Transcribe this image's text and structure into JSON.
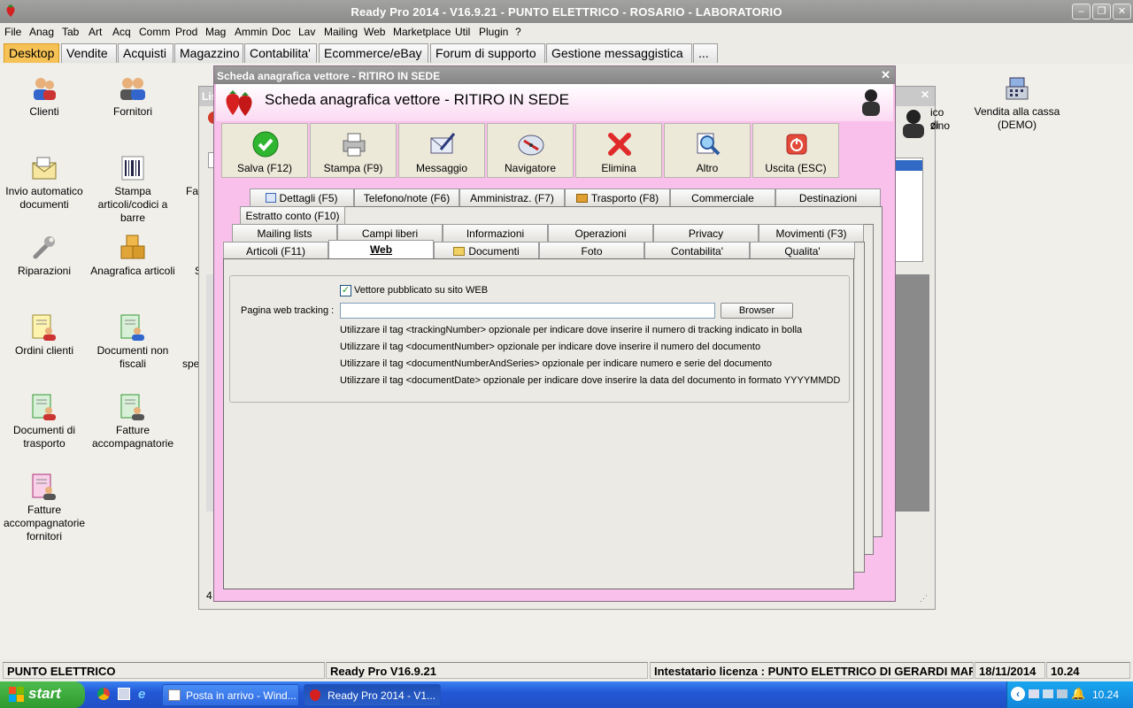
{
  "window": {
    "title": "Ready Pro 2014 - V16.9.21 - PUNTO ELETTRICO - ROSARIO - LABORATORIO"
  },
  "menu": [
    "File",
    "Anag",
    "Tab",
    "Art",
    "Acq",
    "Comm",
    "Prod",
    "Mag",
    "Ammin",
    "Doc",
    "Lav",
    "Mailing",
    "Web",
    "Marketplace",
    "Util",
    "Plugin",
    "?"
  ],
  "desktop_tabs": [
    "Desktop",
    "Vendite",
    "Acquisti",
    "Magazzino",
    "Contabilita'",
    "Ecommerce/eBay",
    "Forum di supporto",
    "Gestione messaggistica",
    "..."
  ],
  "desktop_icons": [
    {
      "label": "Clienti",
      "icon": "customers-icon"
    },
    {
      "label": "Fornitori",
      "icon": "suppliers-icon"
    },
    {
      "label": "Invio automatico documenti",
      "icon": "mail-documents-icon"
    },
    {
      "label": "Stampa articoli/codici a barre",
      "icon": "barcode-icon"
    },
    {
      "label": "Riparazioni",
      "icon": "wrench-icon"
    },
    {
      "label": "Anagrafica articoli",
      "icon": "boxes-icon"
    },
    {
      "label": "Ordini clienti",
      "icon": "orders-icon"
    },
    {
      "label": "Documenti non fiscali",
      "icon": "documents-icon"
    },
    {
      "label": "Documenti di trasporto",
      "icon": "transport-docs-icon"
    },
    {
      "label": "Fatture accompagnatorie",
      "icon": "invoices-icon"
    },
    {
      "label": "Fatture accompagnatorie fornitori",
      "icon": "supplier-invoices-icon"
    },
    {
      "label": "Vendita alla cassa (DEMO)",
      "icon": "cash-register-icon"
    }
  ],
  "background_window": {
    "title_fragment": "Lis",
    "right_label_1": "ico di",
    "right_label_2": "zino",
    "partial_left": [
      "Fa",
      "S",
      "spe"
    ],
    "footer_num": "4"
  },
  "dialog": {
    "title": "Scheda anagrafica vettore - RITIRO IN SEDE",
    "header": "Scheda anagrafica vettore - RITIRO IN SEDE",
    "toolbar": [
      "Salva (F12)",
      "Stampa (F9)",
      "Messaggio",
      "Navigatore",
      "Elimina",
      "Altro",
      "Uscita (ESC)"
    ],
    "tabs_row1": [
      "Dettagli (F5)",
      "Telefono/note (F6)",
      "Amministraz. (F7)",
      "Trasporto (F8)",
      "Commerciale",
      "Destinazioni"
    ],
    "tabs_row2": [
      "Estratto conto (F10)"
    ],
    "tabs_row3": [
      "Mailing lists",
      "Campi liberi",
      "Informazioni",
      "Operazioni",
      "Privacy",
      "Movimenti (F3)"
    ],
    "tabs_row4": [
      "Articoli (F11)",
      "Web",
      "Documenti",
      "Foto",
      "Contabilita'",
      "Qualita'"
    ],
    "web": {
      "checkbox_label": "Vettore pubblicato su sito WEB",
      "checkbox_checked": true,
      "tracking_label": "Pagina web tracking :",
      "tracking_value": "",
      "browser_button": "Browser",
      "hints": [
        "Utilizzare il tag <trackingNumber> opzionale per indicare dove inserire il numero di tracking indicato in bolla",
        "Utilizzare il tag <documentNumber> opzionale per indicare dove inserire il numero del documento",
        "Utilizzare il tag <documentNumberAndSeries> opzionale per indicare numero e serie del documento",
        "Utilizzare il tag <documentDate> opzionale per indicare dove inserire la data del documento in formato YYYYMMDD"
      ]
    }
  },
  "statusbar": {
    "company": "PUNTO ELETTRICO",
    "version": "Ready Pro V16.9.21",
    "license": "Intestatario licenza : PUNTO ELETTRICO DI GERARDI MARTA",
    "date": "18/11/2014",
    "time": "10.24"
  },
  "taskbar": {
    "start": "start",
    "items": [
      "Posta in arrivo - Wind...",
      "Ready Pro 2014 - V1..."
    ],
    "clock": "10.24"
  },
  "colors": {
    "dialog_bg": "#fac0ec",
    "active_tab": "#f7c255",
    "taskbar": "#2358d6",
    "start": "#3aa83a"
  }
}
